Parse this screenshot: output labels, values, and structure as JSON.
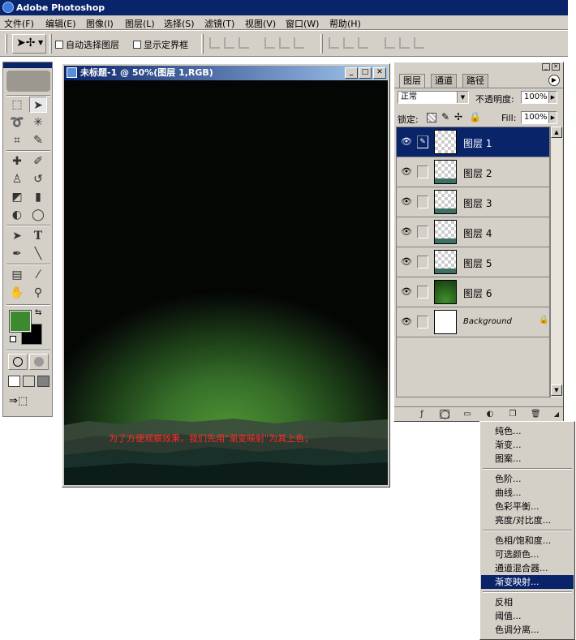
{
  "app": {
    "title": "Adobe Photoshop"
  },
  "menubar": [
    "文件(F)",
    "编辑(E)",
    "图像(I)",
    "图层(L)",
    "选择(S)",
    "滤镜(T)",
    "视图(V)",
    "窗口(W)",
    "帮助(H)"
  ],
  "options_bar": {
    "auto_select_label": "自动选择图层",
    "show_bounds_label": "显示定界框"
  },
  "document": {
    "title": "未标题-1 @ 50%(图层 1,RGB)",
    "caption": "为了方便观察效果，我们先用\"渐变映射\"为其上色；"
  },
  "layers_panel": {
    "tabs": [
      "图层",
      "通道",
      "路径"
    ],
    "blend_mode": "正常",
    "opacity_label": "不透明度:",
    "opacity_value": "100%",
    "lock_label": "锁定:",
    "fill_label": "Fill:",
    "fill_value": "100%",
    "layers": [
      {
        "name": "图层 1",
        "selected": true,
        "thumb": "transparent"
      },
      {
        "name": "图层 2",
        "selected": false,
        "thumb": "hill"
      },
      {
        "name": "图层 3",
        "selected": false,
        "thumb": "hill"
      },
      {
        "name": "图层 4",
        "selected": false,
        "thumb": "hill"
      },
      {
        "name": "图层 5",
        "selected": false,
        "thumb": "hill"
      },
      {
        "name": "图层 6",
        "selected": false,
        "thumb": "green"
      },
      {
        "name": "Background",
        "selected": false,
        "thumb": "white"
      }
    ]
  },
  "adjustment_menu": {
    "groups": [
      [
        "纯色...",
        "渐变...",
        "图案..."
      ],
      [
        "色阶...",
        "曲线...",
        "色彩平衡...",
        "亮度/对比度..."
      ],
      [
        "色相/饱和度...",
        "可选颜色...",
        "通道混合器...",
        "渐变映射..."
      ],
      [
        "反相",
        "阈值...",
        "色调分离..."
      ]
    ],
    "highlighted": "渐变映射..."
  },
  "colors": {
    "title_bar": "#0a246a",
    "foreground": "#3d8a2e",
    "background": "#000000",
    "caption": "#ff2a2a"
  }
}
